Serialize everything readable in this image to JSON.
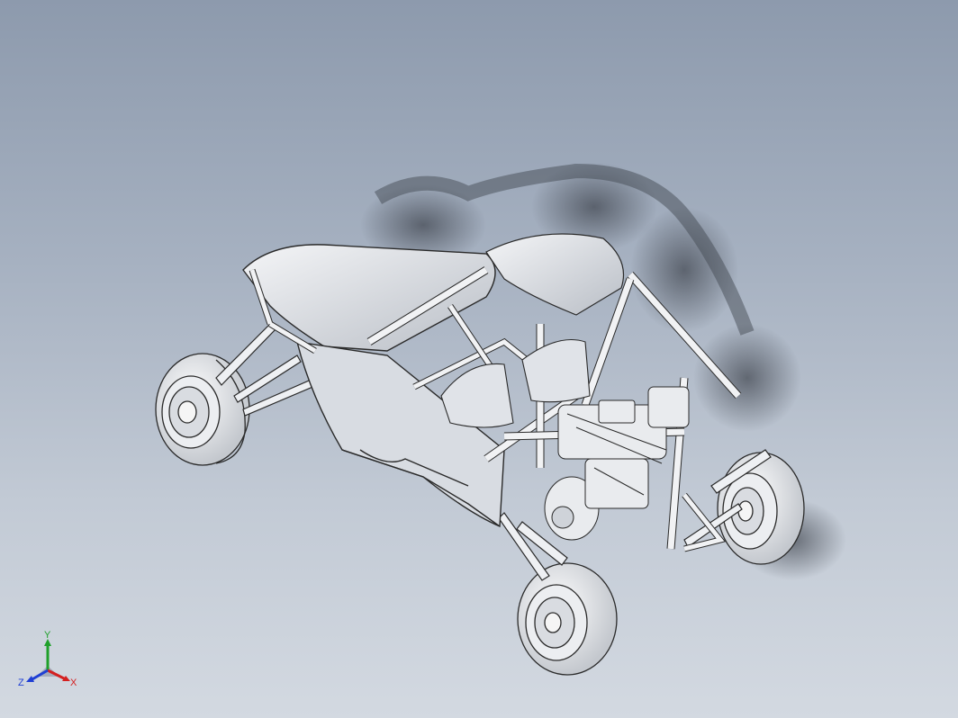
{
  "viewport": {
    "background_top": "#8d9aad",
    "background_bottom": "#d3d9e1"
  },
  "model": {
    "name": "off-road-buggy-frame",
    "line_color": "#2a2a2a",
    "fill_color": "#e6e8ec",
    "shadow_color": "#3a3f48"
  },
  "triad": {
    "x_label": "X",
    "y_label": "Y",
    "z_label": "Z",
    "x_color": "#d42020",
    "y_color": "#1fa02a",
    "z_color": "#1f3fd4"
  }
}
